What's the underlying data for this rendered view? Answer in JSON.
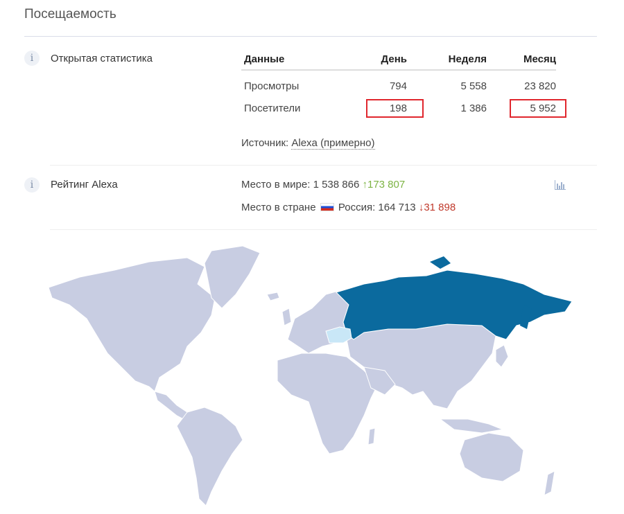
{
  "title": "Посещаемость",
  "open_stats": {
    "label": "Открытая статистика",
    "headers": [
      "Данные",
      "День",
      "Неделя",
      "Месяц"
    ],
    "rows": [
      {
        "name": "Просмотры",
        "day": "794",
        "week": "5 558",
        "month": "23 820"
      },
      {
        "name": "Посетители",
        "day": "198",
        "week": "1 386",
        "month": "5 952"
      }
    ],
    "source_label": "Источник:",
    "source_link": "Alexa (примерно)"
  },
  "alexa": {
    "label": "Рейтинг Alexa",
    "world_label": "Место в мире:",
    "world_value": "1 538 866",
    "world_change": "173 807",
    "world_change_dir": "up",
    "country_label": "Место в стране",
    "country_name": "Россия:",
    "country_value": "164 713",
    "country_change": "31 898",
    "country_change_dir": "down"
  },
  "info_glyph": "i",
  "icons": {
    "info": "info-icon",
    "chart": "bar-chart-icon",
    "up": "arrow-up-icon",
    "down": "arrow-down-icon",
    "flag": "russia-flag-icon"
  },
  "colors": {
    "highlight": "#e0262d",
    "russia": "#0b6a9e",
    "ukraine": "#c9e7f7",
    "land": "#c8cde2",
    "up": "#7cb342",
    "down": "#c0392b"
  }
}
